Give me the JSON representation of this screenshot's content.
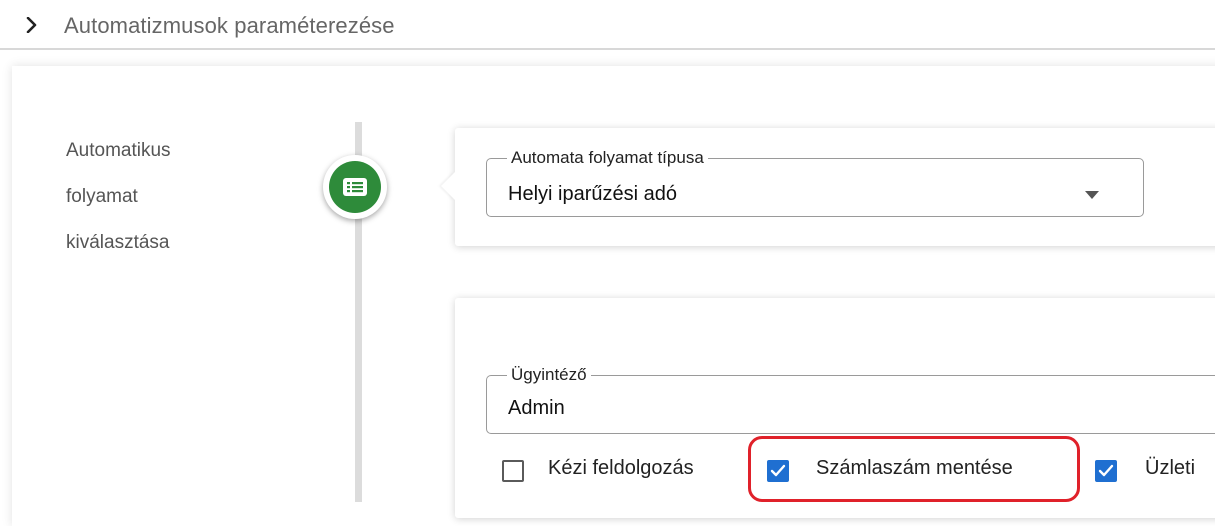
{
  "header": {
    "title": "Automatizmusok paraméterezése"
  },
  "step": {
    "label_lines": [
      "Automatikus",
      "folyamat",
      "kiválasztása"
    ],
    "icon": "list-icon",
    "icon_color": "#2e8b3a"
  },
  "process_type": {
    "legend": "Automata folyamat típusa",
    "value": "Helyi iparűzési adó"
  },
  "assignee": {
    "legend": "Ügyintéző",
    "value": "Admin"
  },
  "checkboxes": [
    {
      "label": "Kézi feldolgozás",
      "checked": false
    },
    {
      "label": "Számlaszám mentése",
      "checked": true
    },
    {
      "label": "Üzleti",
      "checked": true
    }
  ],
  "colors": {
    "accent": "#1f6fd1",
    "highlight": "#e0212a"
  }
}
